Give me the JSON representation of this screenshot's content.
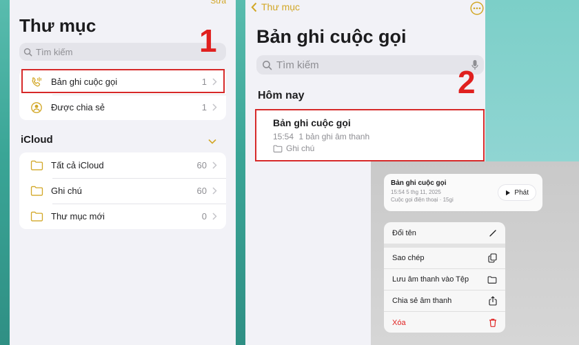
{
  "left": {
    "edit_label": "Sửa",
    "title": "Thư mục",
    "search_placeholder": "Tìm kiếm",
    "top_group": [
      {
        "label": "Bản ghi cuộc gọi",
        "count": "1"
      },
      {
        "label": "Được chia sẻ",
        "count": "1"
      }
    ],
    "icloud_header": "iCloud",
    "icloud_group": [
      {
        "label": "Tất cả iCloud",
        "count": "60"
      },
      {
        "label": "Ghi chú",
        "count": "60"
      },
      {
        "label": "Thư mục mới",
        "count": "0"
      }
    ],
    "step": "1"
  },
  "right": {
    "back_label": "Thư mục",
    "title": "Bản ghi cuộc gọi",
    "search_placeholder": "Tìm kiếm",
    "section": "Hôm nay",
    "step": "2",
    "note": {
      "title": "Bản ghi cuộc gọi",
      "time": "15:54",
      "subtitle": "1 bản ghi âm thanh",
      "folder": "Ghi chú"
    }
  },
  "context": {
    "preview_title": "Bản ghi cuộc gọi",
    "preview_date": "15:54 5 thg 11, 2025",
    "preview_meta": "Cuộc gọi điện thoại · 15gi",
    "play_label": "Phát",
    "menu": [
      {
        "label": "Đổi tên",
        "icon": "pencil-icon"
      },
      {
        "label": "Sao chép",
        "icon": "copy-icon"
      },
      {
        "label": "Lưu âm thanh vào Tệp",
        "icon": "folder-icon"
      },
      {
        "label": "Chia sẻ âm thanh",
        "icon": "share-icon"
      },
      {
        "label": "Xóa",
        "icon": "trash-icon"
      }
    ]
  },
  "colors": {
    "accent": "#d2a726",
    "highlight_red": "#d62828",
    "delete_red": "#e0201f"
  }
}
